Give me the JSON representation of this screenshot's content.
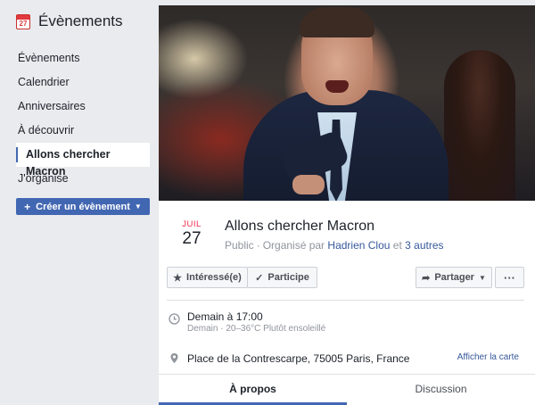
{
  "sidebar": {
    "title": "Évènements",
    "calendar_icon_day": "27",
    "items": [
      {
        "label": "Évènements"
      },
      {
        "label": "Calendrier"
      },
      {
        "label": "Anniversaires"
      },
      {
        "label": "À découvrir"
      },
      {
        "label": "Allons chercher Macron"
      },
      {
        "label": "J'organise"
      }
    ],
    "active_item": "Allons chercher Macron",
    "create_button": "Créer un évènement"
  },
  "event": {
    "month": "JUIL",
    "day": "27",
    "title": "Allons chercher Macron",
    "visibility": "Public",
    "organized_by_prefix": "Organisé par",
    "organizer": "Hadrien Clou",
    "and_word": "et",
    "others": "3 autres",
    "time_main": "Demain à 17:00",
    "time_sub": "Demain · 20–36°C Plutôt ensoleillé",
    "place": "Place de la Contrescarpe, 75005 Paris, France",
    "map_link": "Afficher la carte"
  },
  "actions": {
    "interested": "Intéressé(e)",
    "participate": "Participe",
    "share": "Partager",
    "more": "···"
  },
  "tabs": [
    {
      "label": "À propos",
      "active": true
    },
    {
      "label": "Discussion",
      "active": false
    }
  ],
  "colors": {
    "accent": "#4267b2",
    "link": "#365899",
    "month_red": "#f02849",
    "background": "#e9ebee"
  },
  "icons": {
    "calendar": "calendar-icon",
    "star": "star-icon",
    "check": "check-icon",
    "share": "share-arrow-icon",
    "clock": "clock-icon",
    "pin": "map-pin-icon"
  }
}
